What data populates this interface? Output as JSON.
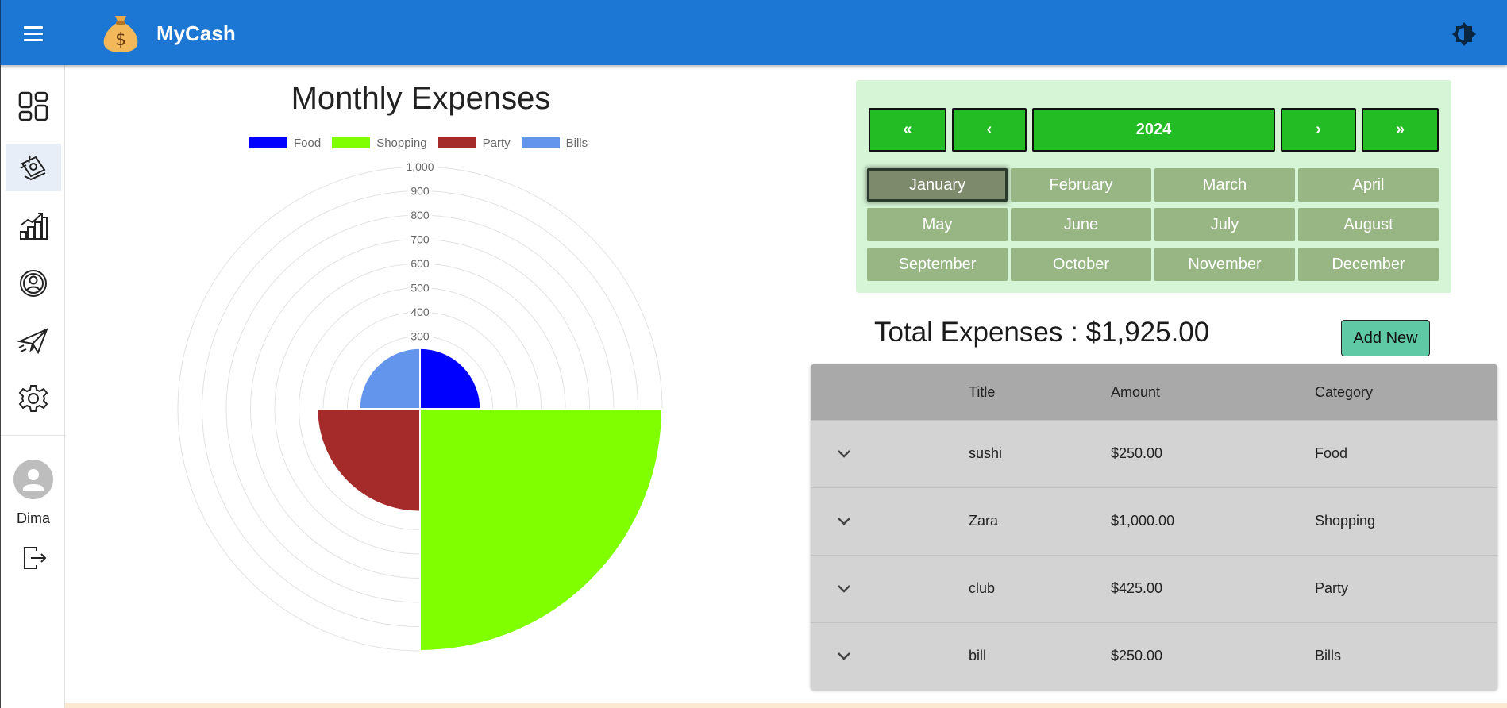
{
  "app": {
    "title": "MyCash"
  },
  "icons": {
    "menu": "menu-icon",
    "logo": "money-bag-icon",
    "theme": "brightness-icon",
    "sidebar": [
      "dashboard-icon",
      "expenses-icon",
      "statistics-icon",
      "profile-icon",
      "send-icon",
      "settings-icon"
    ],
    "logout": "logout-icon",
    "expand": "chevron-down-icon"
  },
  "sidebar": {
    "user_name": "Dima"
  },
  "chart_data": {
    "type": "polarArea",
    "title": "Monthly Expenses",
    "categories": [
      "Food",
      "Shopping",
      "Party",
      "Bills"
    ],
    "values": [
      250,
      1000,
      425,
      250
    ],
    "colors": [
      "#0000ff",
      "#7fff00",
      "#a52a2a",
      "#6495ed"
    ],
    "r_ticks": [
      "1,000",
      "900",
      "800",
      "700",
      "600",
      "500",
      "400",
      "300"
    ],
    "rlim": [
      0,
      1000
    ],
    "legend": "top"
  },
  "picker": {
    "prev_year": "«",
    "prev": "‹",
    "year": "2024",
    "next": "›",
    "next_year": "»",
    "months": [
      "January",
      "February",
      "March",
      "April",
      "May",
      "June",
      "July",
      "August",
      "September",
      "October",
      "November",
      "December"
    ],
    "selected": "January"
  },
  "summary": {
    "total": "Total Expenses : $1,925.00",
    "add_label": "Add New"
  },
  "table": {
    "headers": [
      "Title",
      "Amount",
      "Category"
    ],
    "rows": [
      {
        "title": "sushi",
        "amount": "$250.00",
        "category": "Food"
      },
      {
        "title": "Zara",
        "amount": "$1,000.00",
        "category": "Shopping"
      },
      {
        "title": "club",
        "amount": "$425.00",
        "category": "Party"
      },
      {
        "title": "bill",
        "amount": "$250.00",
        "category": "Bills"
      }
    ]
  },
  "colors": {
    "appbar": "#1c76d3",
    "picker_bg": "#d6f5d6",
    "year_button": "#24bc24",
    "month_button": "#97b684",
    "add_button": "#5ec9a4",
    "table_header": "#a9a9a9",
    "table_body": "#d3d3d3"
  }
}
